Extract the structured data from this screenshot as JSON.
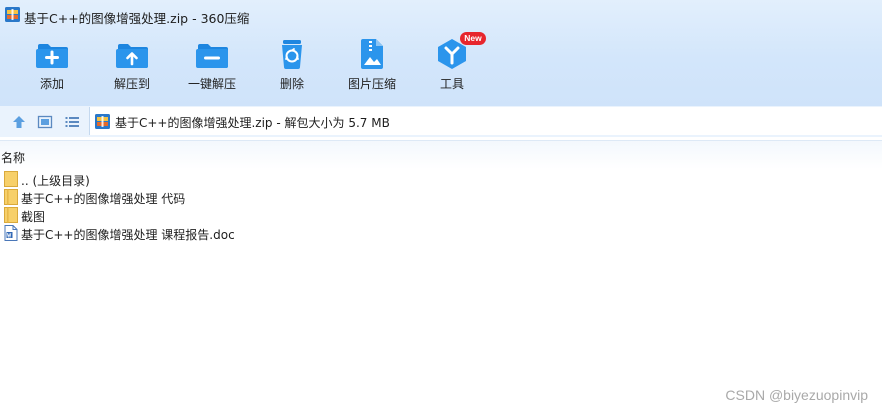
{
  "window": {
    "title": "基于C++的图像增强处理.zip - 360压缩"
  },
  "toolbar": {
    "add_label": "添加",
    "extract_to_label": "解压到",
    "one_click_extract_label": "一键解压",
    "delete_label": "删除",
    "image_compress_label": "图片压缩",
    "tools_label": "工具",
    "tools_badge": "New"
  },
  "address": {
    "text": "基于C++的图像增强处理.zip - 解包大小为 5.7 MB"
  },
  "file_list": {
    "column_name": "名称",
    "items": [
      {
        "name": ".. (上级目录)",
        "type": "folder"
      },
      {
        "name": "基于C++的图像增强处理 代码",
        "type": "folder"
      },
      {
        "name": "截图",
        "type": "folder"
      },
      {
        "name": "基于C++的图像增强处理 课程报告.doc",
        "type": "doc"
      }
    ]
  },
  "watermark": "CSDN @biyezuopinvip",
  "colors": {
    "accent": "#1e88e5",
    "toolbar_bg": "#d5e8fb",
    "badge": "#e7262d",
    "folder": "#f7d06a"
  }
}
